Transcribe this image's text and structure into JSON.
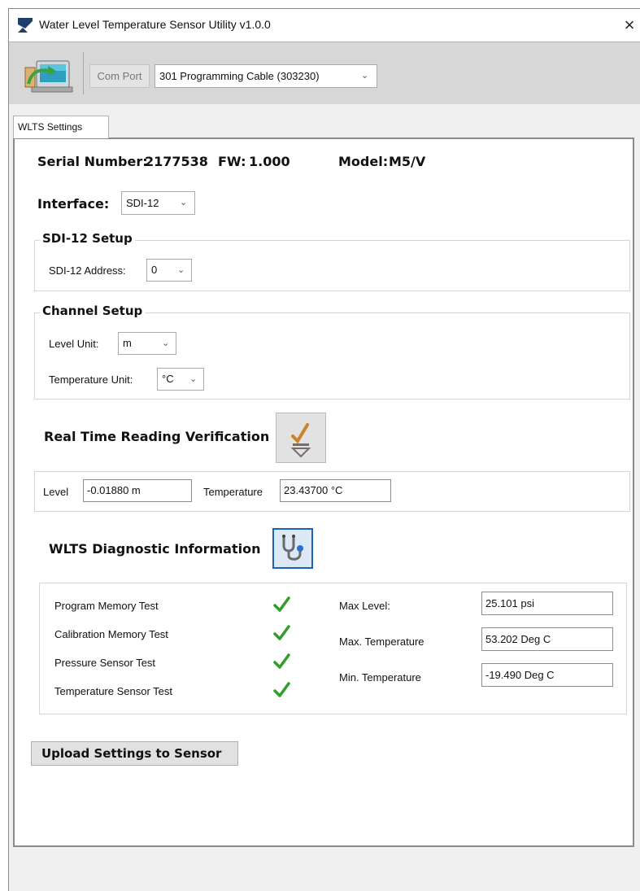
{
  "window": {
    "title": "Water Level Temperature Sensor Utility v1.0.0",
    "close_glyph": "×"
  },
  "toolbar": {
    "com_port_label": "Com Port",
    "com_port_value": "301 Programming Cable (303230)"
  },
  "tabs": [
    {
      "label": "WLTS Settings",
      "active": true
    }
  ],
  "device": {
    "serial_label": "Serial Number:",
    "serial_value": "2177538",
    "fw_label": "FW:",
    "fw_value": "1.000",
    "model_label": "Model:",
    "model_value": "M5/V"
  },
  "interface": {
    "label": "Interface:",
    "value": "SDI-12"
  },
  "sdi12_setup": {
    "title": "SDI-12 Setup",
    "address_label": "SDI-12 Address:",
    "address_value": "0"
  },
  "channel_setup": {
    "title": "Channel Setup",
    "level_unit_label": "Level Unit:",
    "level_unit_value": "m",
    "temp_unit_label": "Temperature Unit:",
    "temp_unit_value": "°C"
  },
  "real_time": {
    "title": "Real Time Reading Verification",
    "level_label": "Level",
    "level_value": "-0.01880 m",
    "temp_label": "Temperature",
    "temp_value": "23.43700 °C"
  },
  "diagnostics": {
    "title": "WLTS Diagnostic Information",
    "tests": [
      {
        "label": "Program Memory Test",
        "passed": true
      },
      {
        "label": "Calibration Memory Test",
        "passed": true
      },
      {
        "label": "Pressure Sensor Test",
        "passed": true
      },
      {
        "label": "Temperature Sensor Test",
        "passed": true
      }
    ],
    "max_level_label": "Max Level:",
    "max_level_value": "25.101 psi",
    "max_temp_label": "Max. Temperature",
    "max_temp_value": "53.202 Deg C",
    "min_temp_label": "Min. Temperature",
    "min_temp_value": "-19.490 Deg C"
  },
  "upload_button_label": "Upload Settings to Sensor",
  "icons": {
    "app": "app-icon",
    "close": "close-icon",
    "connect": "connect-icon",
    "chevron": "chevron-down-icon",
    "read": "read-reading-icon",
    "diagnostic": "stethoscope-icon",
    "check": "green-check-icon"
  },
  "colors": {
    "check_green": "#2f9e2a",
    "diagnostic_highlight": "#1b62b5",
    "toolbar_bg": "#d7d7d7"
  }
}
